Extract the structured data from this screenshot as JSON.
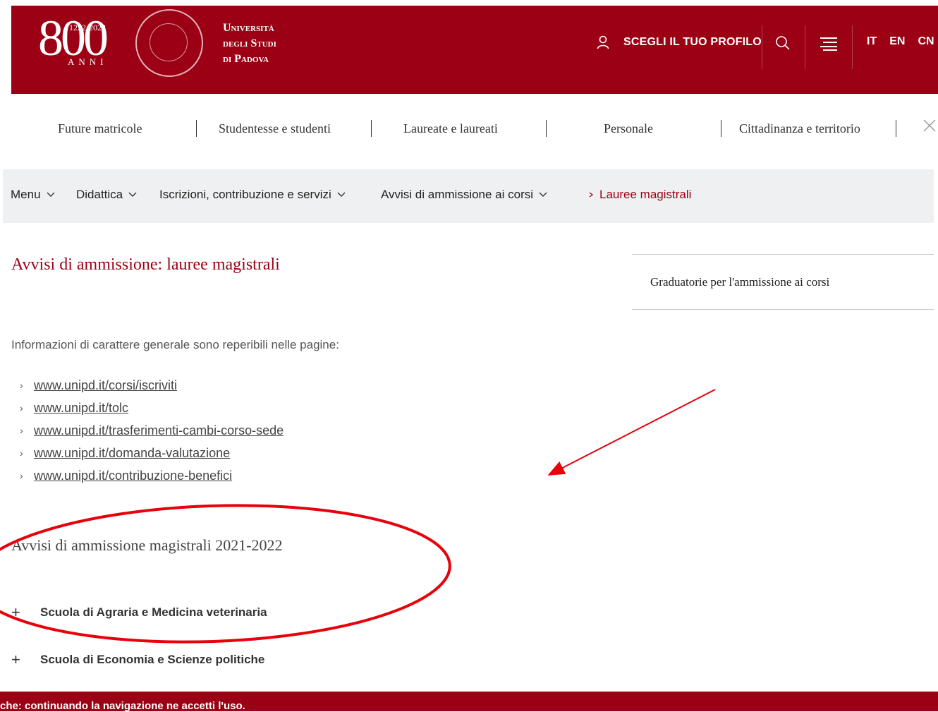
{
  "header": {
    "logo_number": "800",
    "logo_years": "1222·2022",
    "logo_anni": "ANNI",
    "university_name": [
      "Università",
      "degli Studi",
      "di Padova"
    ],
    "profile_label": "SCEGLI IL TUO PROFILO",
    "languages": [
      "IT",
      "EN",
      "CN"
    ]
  },
  "audience_nav": {
    "items": [
      "Future matricole",
      "Studentesse e studenti",
      "Laureate e laureati",
      "Personale",
      "Cittadinanza e territorio"
    ]
  },
  "breadcrumb": {
    "items": [
      "Menu",
      "Didattica",
      "Iscrizioni, contribuzione e servizi",
      "Avvisi di ammissione ai corsi"
    ],
    "current": "Lauree magistrali"
  },
  "main": {
    "title": "Avvisi di ammissione: lauree magistrali",
    "intro": "Informazioni di carattere generale sono reperibili nelle pagine:",
    "links": [
      "www.unipd.it/corsi/iscriviti",
      "www.unipd.it/tolc",
      "www.unipd.it/trasferimenti-cambi-corso-sede",
      "www.unipd.it/domanda-valutazione",
      "www.unipd.it/contribuzione-benefici"
    ],
    "section_title": "Avvisi di ammissione magistrali 2021-2022",
    "accordion": [
      "Scuola di Agraria e Medicina veterinaria",
      "Scuola di Economia e Scienze politiche"
    ]
  },
  "sidebar": {
    "link": "Graduatorie per l'ammissione ai corsi"
  },
  "cookie_bar": {
    "text": "che: continuando la navigazione ne accetti l'uso."
  },
  "colors": {
    "brand": "#9b0014",
    "annotation": "#e8000b"
  }
}
